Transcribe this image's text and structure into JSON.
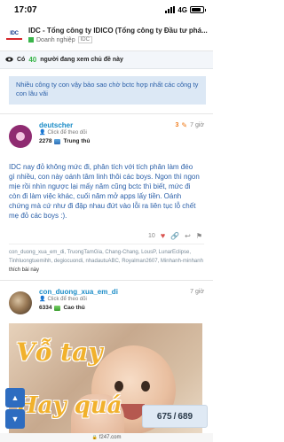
{
  "status": {
    "time": "17:07",
    "network": "4G"
  },
  "topic": {
    "logo_text": "IDC",
    "title": "IDC - Tổng công ty IDICO (Tổng công ty Đầu tư phá...",
    "category": "Doanh nghiệp",
    "tag": "IDC",
    "category_color": "#3ab54a"
  },
  "viewers": {
    "prefix": "Có",
    "count": "40",
    "suffix": "người đang xem chủ đề này",
    "icon": "eye-icon"
  },
  "quote": {
    "text": "Nhiều công ty con vậy bảo sao chờ bctc hợp nhất các công ty con lâu vãi"
  },
  "post1": {
    "username": "deutscher",
    "hint": "Click để theo dõi",
    "reply_number": "3",
    "time": "7 giờ",
    "stat_count": "2278",
    "rank": "Trung thủ",
    "body": "IDC nay đỏ không mức đi, phân tích với tích phân làm đéo gì nhiều, con này oánh tâm linh thôi các boys. Ngon thì ngon mịe rồi nhìn ngược lại mấy năm cũng bctc thì biết, mức đi còn đi làm việc khác, cuối năm mở apps lấy tiền. Oánh chứng mà cứ như đi đập nhau đứt vào lỗi ra liên tục lỗ chết mẹ đỏ các boys :).",
    "likes": "10",
    "likers": "con_duong_xua_em_di, TruongTamGia, Chang-Chang, LousP, LunarEclipse, Tinhluongtuemihh, degiocuondi, nhadautuABC, Royalman2607, Minhanh-minhanh",
    "likers_suffix": "thích bài này"
  },
  "post2": {
    "username": "con_duong_xua_em_di",
    "hint": "Click để theo dõi",
    "time": "7 giờ",
    "stat_count": "6334",
    "rank": "Cao thủ",
    "image_text_line1": "Vỗ tay",
    "image_text_line2": "Hay quá"
  },
  "navigation": {
    "current": "675",
    "separator": "/",
    "total": "689"
  },
  "browser": {
    "url": "f247.com"
  },
  "colors": {
    "link": "#1a8cc7",
    "accent_orange": "#f07b1a",
    "nav_blue": "#2d6cc0",
    "post_text": "#2a5fa8"
  }
}
